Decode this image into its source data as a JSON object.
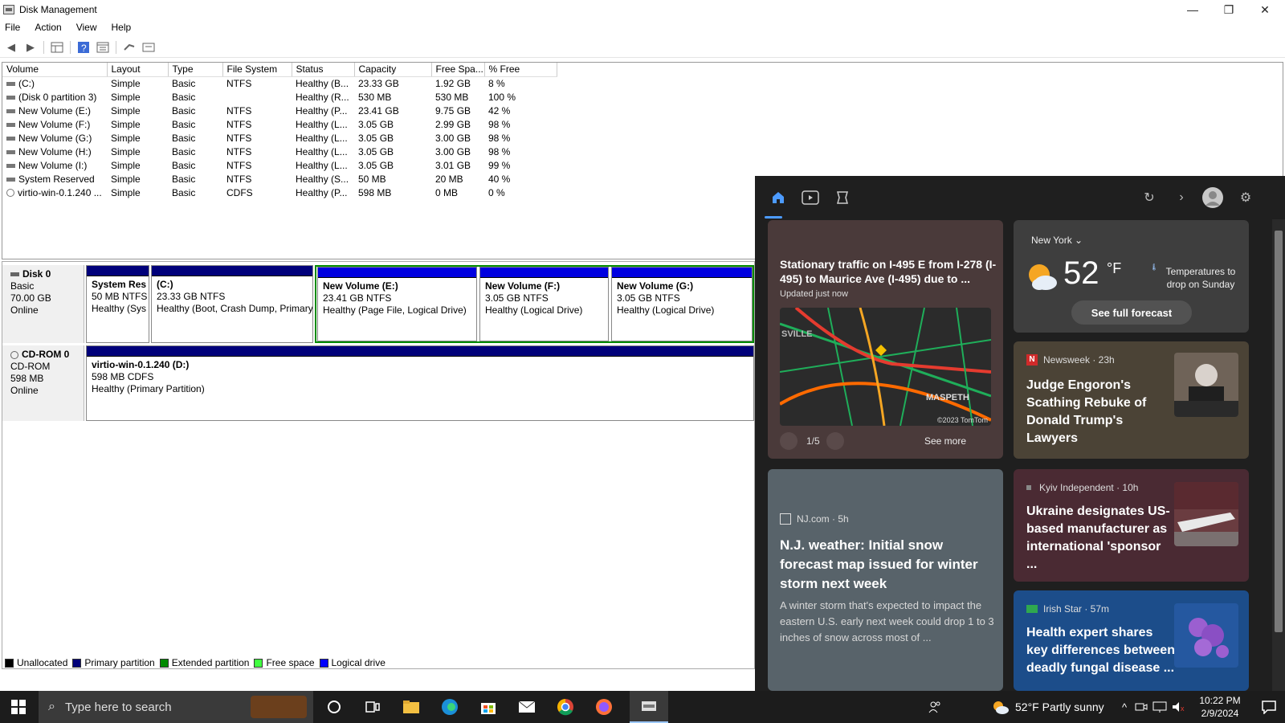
{
  "window": {
    "title": "Disk Management",
    "controls": {
      "minimize": "—",
      "maximize": "❐",
      "close": "✕"
    }
  },
  "menu": [
    "File",
    "Action",
    "View",
    "Help"
  ],
  "volume_list": {
    "columns": [
      "Volume",
      "Layout",
      "Type",
      "File System",
      "Status",
      "Capacity",
      "Free Spa...",
      "% Free"
    ],
    "rows": [
      [
        "(C:)",
        "Simple",
        "Basic",
        "NTFS",
        "Healthy (B...",
        "23.33 GB",
        "1.92 GB",
        "8 %"
      ],
      [
        "(Disk 0 partition 3)",
        "Simple",
        "Basic",
        "",
        "Healthy (R...",
        "530 MB",
        "530 MB",
        "100 %"
      ],
      [
        "New Volume (E:)",
        "Simple",
        "Basic",
        "NTFS",
        "Healthy (P...",
        "23.41 GB",
        "9.75 GB",
        "42 %"
      ],
      [
        "New Volume (F:)",
        "Simple",
        "Basic",
        "NTFS",
        "Healthy (L...",
        "3.05 GB",
        "2.99 GB",
        "98 %"
      ],
      [
        "New Volume (G:)",
        "Simple",
        "Basic",
        "NTFS",
        "Healthy (L...",
        "3.05 GB",
        "3.00 GB",
        "98 %"
      ],
      [
        "New Volume (H:)",
        "Simple",
        "Basic",
        "NTFS",
        "Healthy (L...",
        "3.05 GB",
        "3.00 GB",
        "98 %"
      ],
      [
        "New Volume (I:)",
        "Simple",
        "Basic",
        "NTFS",
        "Healthy (L...",
        "3.05 GB",
        "3.01 GB",
        "99 %"
      ],
      [
        "System Reserved",
        "Simple",
        "Basic",
        "NTFS",
        "Healthy (S...",
        "50 MB",
        "20 MB",
        "40 %"
      ],
      [
        "virtio-win-0.1.240 ...",
        "Simple",
        "Basic",
        "CDFS",
        "Healthy (P...",
        "598 MB",
        "0 MB",
        "0 %"
      ]
    ]
  },
  "disks": {
    "disk0": {
      "name": "Disk 0",
      "type": "Basic",
      "size": "70.00 GB",
      "state": "Online",
      "partitions": [
        {
          "name": "System Res",
          "size": "50 MB NTFS",
          "status": "Healthy (Sys"
        },
        {
          "name": "(C:)",
          "size": "23.33 GB NTFS",
          "status": "Healthy (Boot, Crash Dump, Primary"
        },
        {
          "name": "New Volume  (E:)",
          "size": "23.41 GB NTFS",
          "status": "Healthy (Page File, Logical Drive)"
        },
        {
          "name": "New Volume  (F:)",
          "size": "3.05 GB NTFS",
          "status": "Healthy (Logical Drive)"
        },
        {
          "name": "New Volume  (G:)",
          "size": "3.05 GB NTFS",
          "status": "Healthy (Logical Drive)"
        }
      ]
    },
    "cdrom0": {
      "name": "CD-ROM 0",
      "type": "CD-ROM",
      "size": "598 MB",
      "state": "Online",
      "partition": {
        "name": "virtio-win-0.1.240  (D:)",
        "size": "598 MB CDFS",
        "status": "Healthy (Primary Partition)"
      }
    }
  },
  "legend": [
    {
      "label": "Unallocated",
      "color": "#000000"
    },
    {
      "label": "Primary partition",
      "color": "#00007a"
    },
    {
      "label": "Extended partition",
      "color": "#008a00"
    },
    {
      "label": "Free space",
      "color": "#40ff40"
    },
    {
      "label": "Logical drive",
      "color": "#0000ff"
    }
  ],
  "widgets": {
    "traffic": {
      "headline": "Stationary traffic on I-495 E from I-278 (I-495) to Maurice Ave (I-495) due to ...",
      "updated": "Updated just now",
      "map_labels": {
        "left": "SVILLE",
        "right": "MASPETH",
        "credit": "©2023 TomTom"
      },
      "pager": "1/5",
      "see_more": "See more"
    },
    "weather": {
      "location": "New York",
      "temp": "52",
      "unit": "°F",
      "note": "Temperatures to drop on Sunday",
      "forecast_button": "See full forecast"
    },
    "news1": {
      "source": "Newsweek · 23h",
      "source_icon": "N",
      "headline": "Judge Engoron's Scathing Rebuke of Donald Trump's Lawyers"
    },
    "news2": {
      "source": "NJ.com · 5h",
      "headline": "N.J. weather: Initial snow forecast map issued for winter storm next week",
      "summary": "A winter storm that's expected to impact the eastern U.S. early next week could drop 1 to 3 inches of snow across most of ..."
    },
    "news3": {
      "source": "Kyiv Independent · 10h",
      "headline": "Ukraine designates US-based manufacturer as international 'sponsor ..."
    },
    "news4": {
      "source": "Irish Star · 57m",
      "headline": "Health expert shares key differences between deadly fungal disease ..."
    }
  },
  "taskbar": {
    "search_placeholder": "Type here to search",
    "weather": "52°F  Partly sunny",
    "time": "10:22 PM",
    "date": "2/9/2024"
  }
}
